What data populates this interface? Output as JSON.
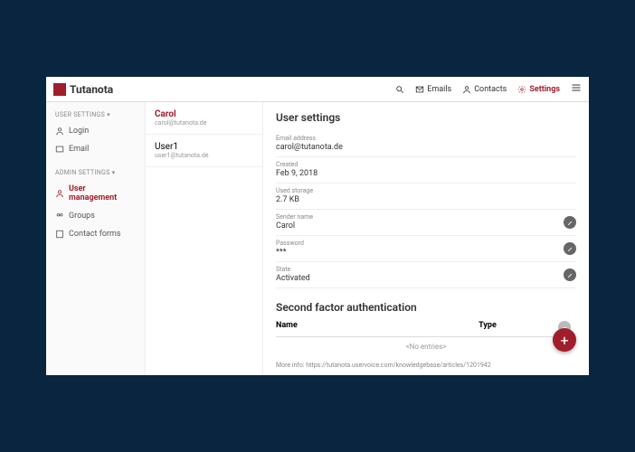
{
  "brand": "Tutanota",
  "nav": {
    "emails": "Emails",
    "contacts": "Contacts",
    "settings": "Settings"
  },
  "sidebar": {
    "user_section": "USER SETTINGS ▾",
    "login": "Login",
    "email": "Email",
    "admin_section": "ADMIN SETTINGS ▾",
    "user_management": "User management",
    "groups": "Groups",
    "contact_forms": "Contact forms"
  },
  "userlist": [
    {
      "name": "Carol",
      "email": "carol@tutanota.de"
    },
    {
      "name": "User1",
      "email": "user1@tutanota.de"
    }
  ],
  "settings": {
    "title": "User settings",
    "email_label": "Email address",
    "email_value": "carol@tutanota.de",
    "created_label": "Created",
    "created_value": "Feb 9, 2018",
    "storage_label": "Used storage",
    "storage_value": "2.7 KB",
    "sender_label": "Sender name",
    "sender_value": "Carol",
    "password_label": "Password",
    "password_value": "***",
    "state_label": "State",
    "state_value": "Activated"
  },
  "second_factor": {
    "title": "Second factor authentication",
    "th_name": "Name",
    "th_type": "Type",
    "no_entries": "<No entries>",
    "more_info_prefix": "More info: ",
    "more_info_link": "https://tutanota.uservoice.com/knowledgebase/articles/1201942"
  }
}
